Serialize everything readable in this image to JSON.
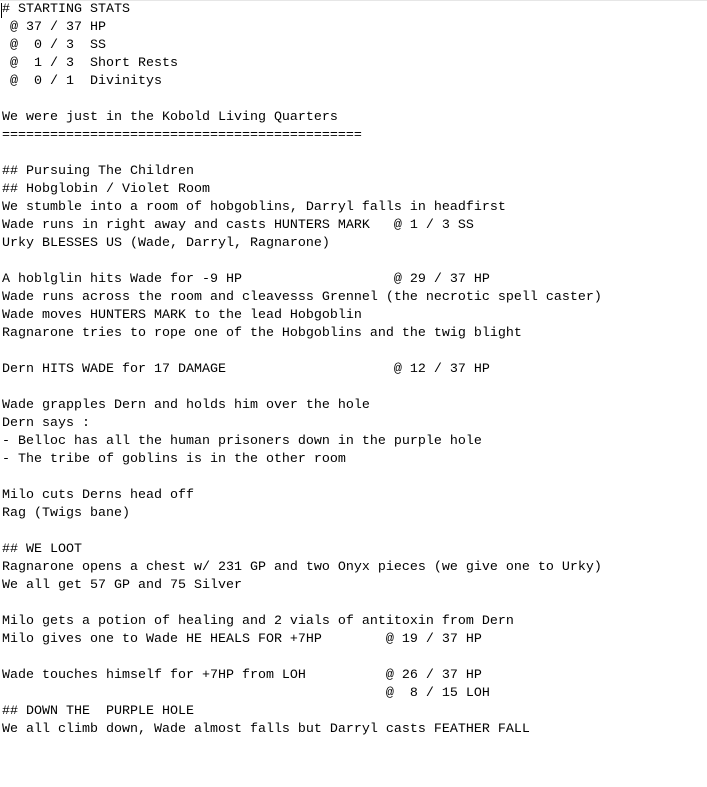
{
  "editor": {
    "lines": [
      "# STARTING STATS",
      " @ 37 / 37 HP",
      " @  0 / 3  SS",
      " @  1 / 3  Short Rests",
      " @  0 / 1  Divinitys",
      "",
      "We were just in the Kobold Living Quarters",
      "=============================================",
      "",
      "## Pursuing The Children",
      "## Hobglobin / Violet Room",
      "We stumble into a room of hobgoblins, Darryl falls in headfirst",
      "Wade runs in right away and casts HUNTERS MARK   @ 1 / 3 SS",
      "Urky BLESSES US (Wade, Darryl, Ragnarone)",
      "",
      "A hoblglin hits Wade for -9 HP                   @ 29 / 37 HP",
      "Wade runs across the room and cleavesss Grennel (the necrotic spell caster)",
      "Wade moves HUNTERS MARK to the lead Hobgoblin",
      "Ragnarone tries to rope one of the Hobgoblins and the twig blight",
      "",
      "Dern HITS WADE for 17 DAMAGE                     @ 12 / 37 HP",
      "",
      "Wade grapples Dern and holds him over the hole",
      "Dern says :",
      "- Belloc has all the human prisoners down in the purple hole",
      "- The tribe of goblins is in the other room",
      "",
      "Milo cuts Derns head off",
      "Rag (Twigs bane)",
      "",
      "## WE LOOT",
      "Ragnarone opens a chest w/ 231 GP and two Onyx pieces (we give one to Urky)",
      "We all get 57 GP and 75 Silver",
      "",
      "Milo gets a potion of healing and 2 vials of antitoxin from Dern",
      "Milo gives one to Wade HE HEALS FOR +7HP        @ 19 / 37 HP",
      "",
      "Wade touches himself for +7HP from LOH          @ 26 / 37 HP",
      "                                                @  8 / 15 LOH",
      "## DOWN THE  PURPLE HOLE",
      "We all climb down, Wade almost falls but Darryl casts FEATHER FALL"
    ]
  }
}
